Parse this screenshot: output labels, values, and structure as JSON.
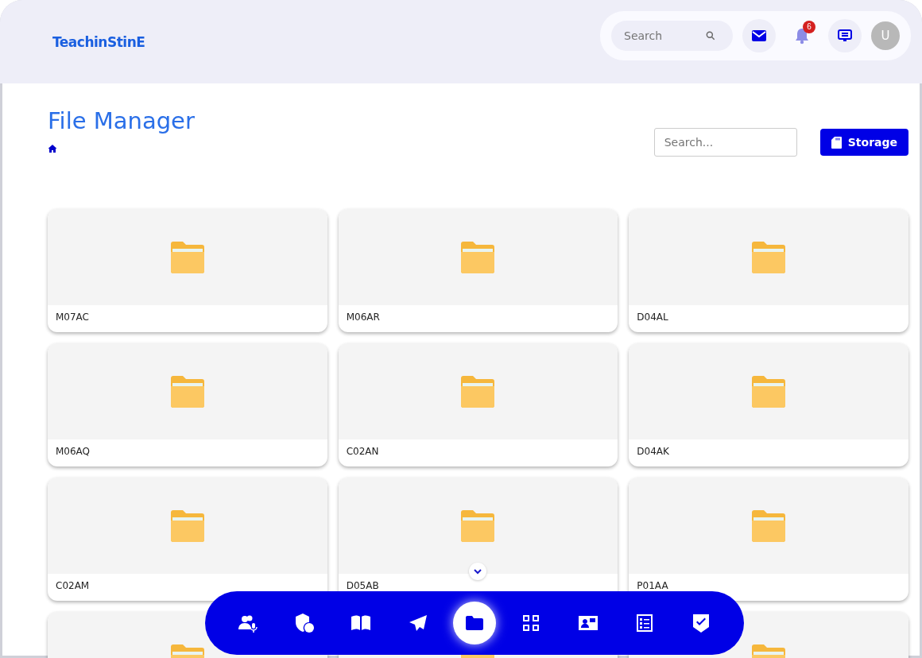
{
  "header": {
    "logo": "TeachinStinE",
    "search": {
      "placeholder": "Search"
    },
    "notifications": "6",
    "avatar": "U"
  },
  "page": {
    "title": "File Manager",
    "search": {
      "placeholder": "Search..."
    },
    "storage_button": "Storage"
  },
  "folders": [
    {
      "kind": "folder",
      "name": "M07AC"
    },
    {
      "kind": "folder",
      "name": "M06AR"
    },
    {
      "kind": "folder",
      "name": "D04AL"
    },
    {
      "kind": "folder",
      "name": "M06AQ"
    },
    {
      "kind": "folder",
      "name": "C02AN"
    },
    {
      "kind": "folder",
      "name": "D04AK"
    },
    {
      "kind": "folder",
      "name": "C02AM"
    },
    {
      "kind": "folder",
      "name": "D05AB"
    },
    {
      "kind": "folder",
      "name": "P01AA"
    },
    {
      "kind": "folder"
    },
    {
      "kind": "folder"
    },
    {
      "kind": "folder"
    }
  ],
  "bottom_nav": [
    {
      "kind": "users-mic",
      "selected": false
    },
    {
      "kind": "shield-user",
      "selected": false
    },
    {
      "kind": "book",
      "selected": false
    },
    {
      "kind": "send",
      "selected": false
    },
    {
      "kind": "folder",
      "selected": true
    },
    {
      "kind": "grid",
      "selected": false
    },
    {
      "kind": "contact-card",
      "selected": false
    },
    {
      "kind": "list",
      "selected": false
    },
    {
      "kind": "check-shield",
      "selected": false
    }
  ]
}
